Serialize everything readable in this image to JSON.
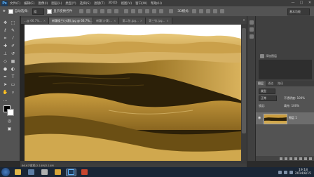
{
  "menu": {
    "logo": "Ps",
    "items": [
      "文件(F)",
      "编辑(E)",
      "图像(I)",
      "图层(L)",
      "类型(Y)",
      "选择(S)",
      "滤镜(T)",
      "3D(D)",
      "视图(V)",
      "窗口(W)",
      "帮助(H)"
    ],
    "minimize": "—",
    "maximize": "□",
    "close": "✕"
  },
  "options": {
    "auto_select_label": "自动选择：",
    "auto_select_value": "组",
    "show_transform_label": "显示变换控件",
    "workspace": "基本功能"
  },
  "tabs": [
    {
      "label": "…@ 66.7%...",
      "active": false
    },
    {
      "label": "新疆楼兰(沙漠).jpg @ 66.7%...",
      "active": true
    },
    {
      "label": "新疆(沙漠)...",
      "active": false
    },
    {
      "label": "第二张.jpg...",
      "active": false
    },
    {
      "label": "第三张.jpg...",
      "active": false
    }
  ],
  "tab_overflow": "»",
  "status": {
    "zoom": "66.67%",
    "doc": "文档:2.14M/2.14M"
  },
  "panel_top": {
    "label": "添加图层"
  },
  "layers": {
    "tabs": [
      "图层",
      "通道",
      "路径"
    ],
    "filter_label": "类型",
    "blend_mode": "正常",
    "opacity_label": "不透明度: 100%",
    "lock_label": "锁定:",
    "fill_label": "填充: 100%",
    "layer_name": "图层 1"
  },
  "taskbar": {
    "clock_time": "19:18",
    "clock_date": "2014/8/15"
  },
  "colors": {
    "fg": "#000000",
    "bg": "#ffffff",
    "accent": "#5fb6ff"
  }
}
